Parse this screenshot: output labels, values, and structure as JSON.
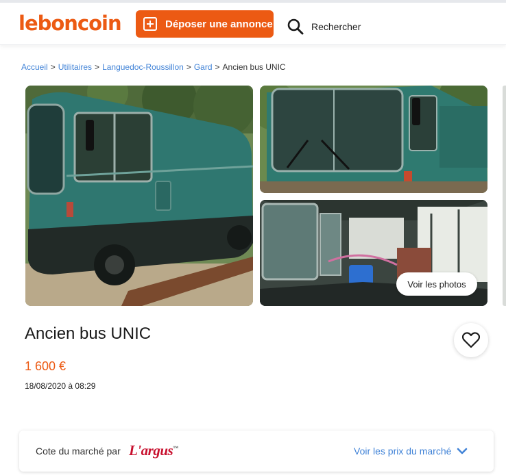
{
  "header": {
    "logo": "leboncoin",
    "post_label": "Déposer une annonce",
    "search_label": "Rechercher"
  },
  "breadcrumb": {
    "items": [
      "Accueil",
      "Utilitaires",
      "Languedoc-Roussillon",
      "Gard"
    ],
    "current": "Ancien bus UNIC",
    "separator": ">"
  },
  "gallery": {
    "view_photos_label": "Voir les photos"
  },
  "listing": {
    "title": "Ancien bus UNIC",
    "price": "1 600 €",
    "date": "18/08/2020 à 08:29"
  },
  "market": {
    "label": "Cote du marché par",
    "brand": "L'argus",
    "brand_mark": "™",
    "link_label": "Voir les prix du marché"
  },
  "colors": {
    "brand_orange": "#ec5a13",
    "link_blue": "#4183d7",
    "argus_red": "#c8102e"
  },
  "icons": {
    "post": "plus-square-icon",
    "search": "search-icon",
    "favorite": "heart-icon",
    "expand": "chevron-down-icon"
  }
}
